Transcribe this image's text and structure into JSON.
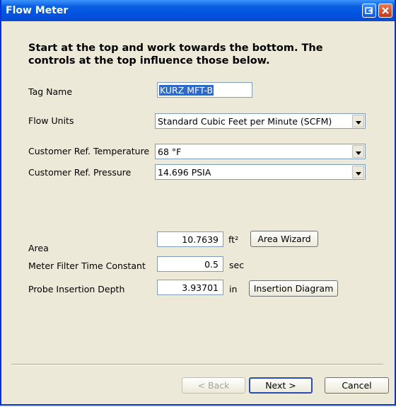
{
  "window": {
    "title": "Flow Meter"
  },
  "instructions": "Start at the top and work towards the bottom.  The controls at the top influence those below.",
  "tag_name": {
    "label": "Tag Name",
    "value": "KURZ MFT-B"
  },
  "flow_units": {
    "label": "Flow Units",
    "value": "Standard Cubic Feet per Minute (SCFM)"
  },
  "ref_temperature": {
    "label": "Customer Ref. Temperature",
    "value": "68 °F"
  },
  "ref_pressure": {
    "label": "Customer Ref. Pressure",
    "value": "14.696 PSIA"
  },
  "area": {
    "label": "Area",
    "value": "10.7639",
    "unit": "ft²",
    "button": "Area Wizard"
  },
  "filter": {
    "label": "Meter Filter Time Constant",
    "value": "0.5",
    "unit": "sec"
  },
  "probe": {
    "label": "Probe Insertion Depth",
    "value": "3.93701",
    "unit": "in",
    "button": "Insertion Diagram"
  },
  "nav": {
    "back": "< Back",
    "next": "Next >",
    "cancel": "Cancel"
  },
  "colors": {
    "titlebar": "#0054e3",
    "selection": "#316ac5",
    "face": "#ece9d8"
  }
}
